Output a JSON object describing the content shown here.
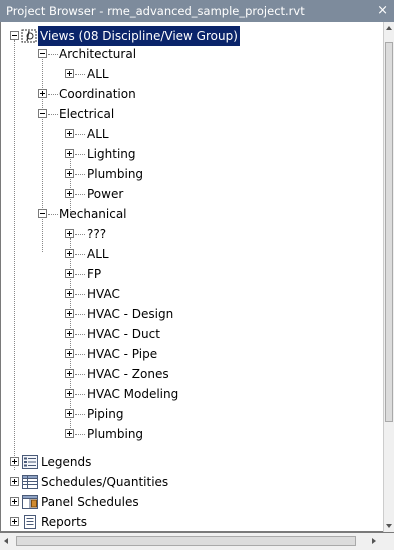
{
  "window": {
    "title": "Project Browser - rme_advanced_sample_project.rvt",
    "close_glyph": "×"
  },
  "tree": {
    "root": "Views (08 Discipline/View Group)",
    "architectural": "Architectural",
    "arch_all": "ALL",
    "coordination": "Coordination",
    "electrical": "Electrical",
    "elec_items": [
      "ALL",
      "Lighting",
      "Plumbing",
      "Power"
    ],
    "mechanical": "Mechanical",
    "mech_items": [
      "???",
      "ALL",
      "FP",
      "HVAC",
      "HVAC - Design",
      "HVAC - Duct",
      "HVAC - Pipe",
      "HVAC - Zones",
      "HVAC Modeling",
      "Piping",
      "Plumbing"
    ],
    "legends": "Legends",
    "schedules": "Schedules/Quantities",
    "panel_schedules": "Panel Schedules",
    "reports": "Reports"
  },
  "colors": {
    "titlebar": "#7d8b9c",
    "selection": "#0a246a"
  }
}
